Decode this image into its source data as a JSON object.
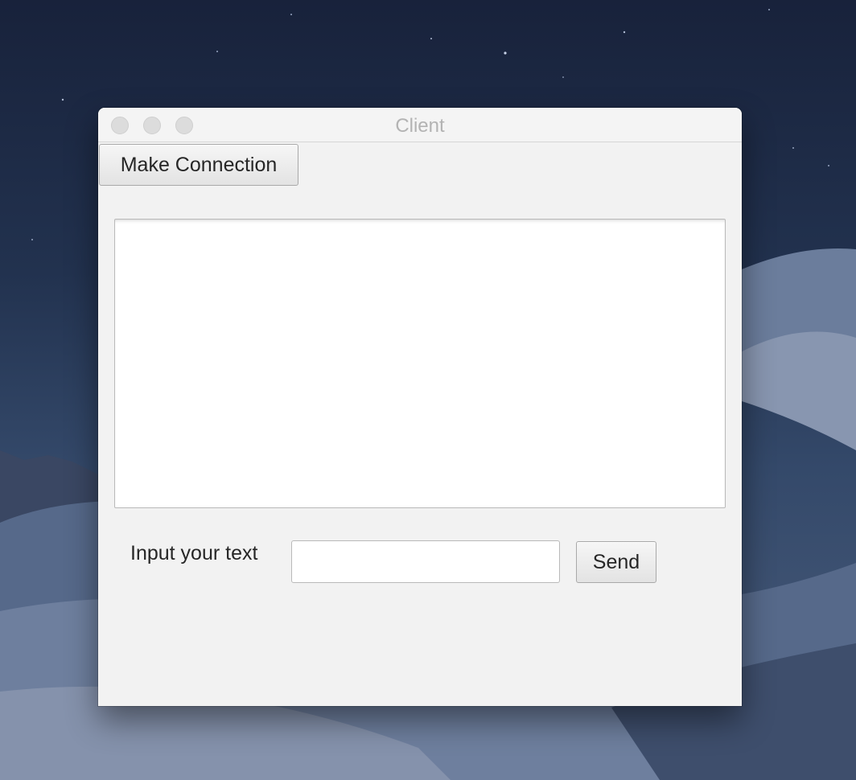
{
  "window": {
    "title": "Client",
    "controls": [
      "close",
      "minimize",
      "zoom"
    ]
  },
  "toolbar": {
    "connect_label": "Make Connection"
  },
  "messages": {
    "content": ""
  },
  "compose": {
    "label": "Input your text",
    "value": "",
    "send_label": "Send"
  }
}
